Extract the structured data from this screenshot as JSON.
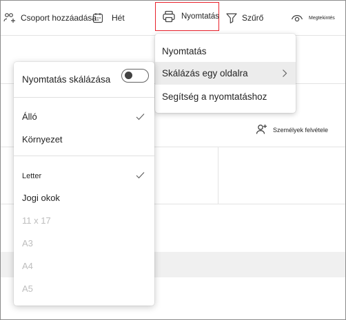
{
  "toolbar": {
    "add_group_label": "Csoport hozzáadása",
    "week_label": "Hét",
    "print_label": "Nyomtatás",
    "filter_label": "Szűrő",
    "view_label": "Megtekintés"
  },
  "add_people_label": "Személyek felvétele",
  "print_menu": {
    "items": [
      {
        "label": "Nyomtatás"
      },
      {
        "label": "Skálázás egy oldalra"
      },
      {
        "label": "Segítség a nyomtatáshoz"
      }
    ]
  },
  "scale_menu": {
    "toggle_label": "Nyomtatás skálázása",
    "toggle_on": false,
    "orientations": [
      {
        "label": "Álló",
        "checked": true
      },
      {
        "label": "Környezet",
        "checked": false
      }
    ],
    "sizes": [
      {
        "label": "Letter",
        "checked": true,
        "disabled": false
      },
      {
        "label": "Jogi okok",
        "checked": false,
        "disabled": false
      },
      {
        "label": "11 x 17",
        "checked": false,
        "disabled": true
      },
      {
        "label": "A3",
        "checked": false,
        "disabled": true
      },
      {
        "label": "A4",
        "checked": false,
        "disabled": true
      },
      {
        "label": "A5",
        "checked": false,
        "disabled": true
      }
    ]
  },
  "colors": {
    "highlight_border": "#e8202a",
    "disabled_text": "#bdbdbd",
    "hover_bg": "#ececec"
  }
}
